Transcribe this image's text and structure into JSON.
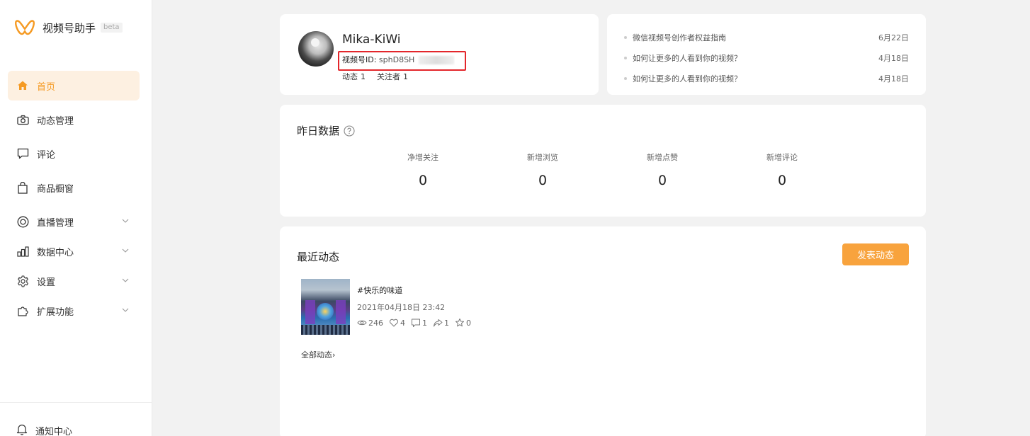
{
  "brand": {
    "name": "视频号助手",
    "badge": "beta",
    "accent": "#f59a23"
  },
  "sidebar": {
    "items": [
      {
        "label": "首页",
        "icon": "home-icon",
        "active": true
      },
      {
        "label": "动态管理",
        "icon": "camera-icon"
      },
      {
        "label": "评论",
        "icon": "comment-icon"
      },
      {
        "label": "商品橱窗",
        "icon": "shopping-bag-icon"
      },
      {
        "label": "直播管理",
        "icon": "live-icon",
        "expandable": true
      },
      {
        "label": "数据中心",
        "icon": "bar-chart-icon",
        "expandable": true
      },
      {
        "label": "设置",
        "icon": "gear-icon",
        "expandable": true
      },
      {
        "label": "扩展功能",
        "icon": "puzzle-icon",
        "expandable": true
      }
    ],
    "notify_label": "通知中心"
  },
  "profile": {
    "name": "Mika-KiWi",
    "id_label": "视频号ID:",
    "id_value": "sphD8SH",
    "posts_label": "动态",
    "posts_count": "1",
    "followers_label": "关注者",
    "followers_count": "1"
  },
  "news": [
    {
      "title": "微信视频号创作者权益指南",
      "date": "6月22日"
    },
    {
      "title": "如何让更多的人看到你的视频？",
      "date": "4月18日"
    },
    {
      "title": "如何让更多的人看到你的视频？",
      "date": "4月18日"
    }
  ],
  "yesterday": {
    "title": "昨日数据",
    "metrics": [
      {
        "label": "净增关注",
        "value": "0"
      },
      {
        "label": "新增浏览",
        "value": "0"
      },
      {
        "label": "新增点赞",
        "value": "0"
      },
      {
        "label": "新增评论",
        "value": "0"
      }
    ]
  },
  "recent": {
    "title": "最近动态",
    "publish_label": "发表动态",
    "post": {
      "title": "#快乐的味道",
      "time": "2021年04月18日 23:42",
      "views": "246",
      "likes": "4",
      "comments": "1",
      "shares": "1",
      "favorites": "0"
    },
    "all_label": "全部动态",
    "all_arrow": "›"
  }
}
